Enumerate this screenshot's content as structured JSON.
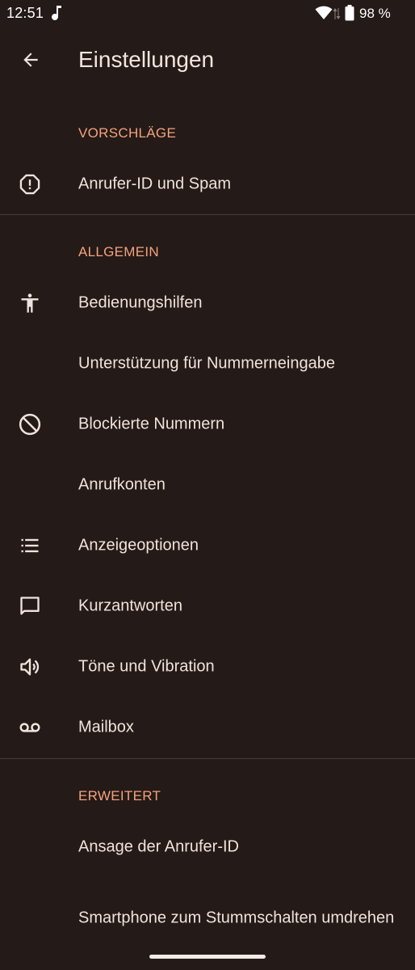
{
  "status_bar": {
    "time": "12:51",
    "battery_percent": "98 %",
    "icons": [
      "music-note-icon",
      "wifi-icon",
      "data-arrows-icon",
      "battery-icon"
    ]
  },
  "app_bar": {
    "title": "Einstellungen",
    "back_icon": "arrow-back-icon"
  },
  "sections": {
    "suggestions": {
      "header": "VORSCHLÄGE",
      "items": [
        {
          "label": "Anrufer-ID und Spam",
          "icon": "alert-octagon-icon"
        }
      ]
    },
    "general": {
      "header": "ALLGEMEIN",
      "items": [
        {
          "label": "Bedienungshilfen",
          "icon": "accessibility-icon"
        },
        {
          "label": "Unterstützung für Nummerneingabe",
          "icon": ""
        },
        {
          "label": "Blockierte Nummern",
          "icon": "block-icon"
        },
        {
          "label": "Anrufkonten",
          "icon": ""
        },
        {
          "label": "Anzeigeoptionen",
          "icon": "list-icon"
        },
        {
          "label": "Kurzantworten",
          "icon": "message-icon"
        },
        {
          "label": "Töne und Vibration",
          "icon": "volume-icon"
        },
        {
          "label": "Mailbox",
          "icon": "voicemail-icon"
        }
      ]
    },
    "advanced": {
      "header": "ERWEITERT",
      "items": [
        {
          "label": "Ansage der Anrufer-ID",
          "icon": ""
        },
        {
          "label": "Smartphone zum Stummschalten umdrehen",
          "icon": ""
        }
      ]
    }
  },
  "colors": {
    "background": "#241a17",
    "accent": "#f4a27f",
    "text": "#efe3dc",
    "divider": "#4a3d37"
  }
}
